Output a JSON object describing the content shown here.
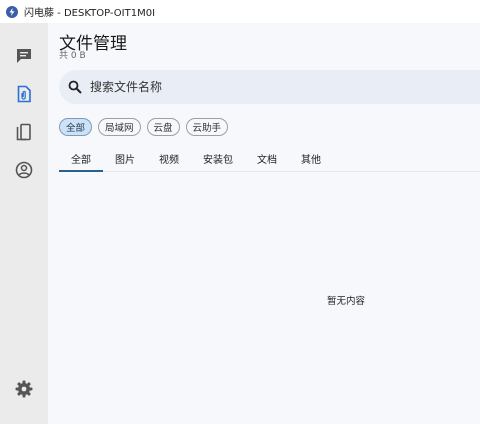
{
  "window": {
    "title": "闪电藤 - DESKTOP-OIT1M0I"
  },
  "sidebar": {
    "items": [
      {
        "icon": "chat-icon"
      },
      {
        "icon": "file-icon"
      },
      {
        "icon": "devices-icon"
      },
      {
        "icon": "account-icon"
      }
    ],
    "settings_icon": "gear-icon"
  },
  "header": {
    "title": "文件管理",
    "subtitle": "共 0 B"
  },
  "search": {
    "placeholder": "搜索文件名称"
  },
  "filters": [
    "全部",
    "局域网",
    "云盘",
    "云助手"
  ],
  "tabs": [
    "全部",
    "图片",
    "视频",
    "安装包",
    "文档",
    "其他"
  ],
  "empty_state": "暂无内容",
  "colors": {
    "accent": "#2c5f8a",
    "sidebar_bg": "#ebebeb",
    "active_chip": "#cfe2f5"
  }
}
